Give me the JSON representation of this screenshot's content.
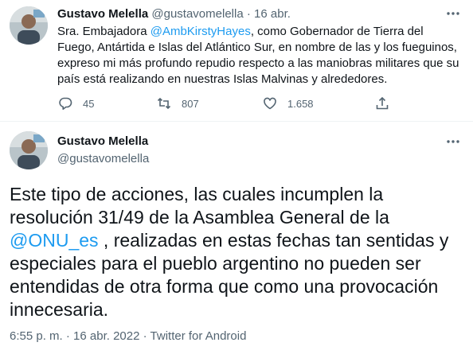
{
  "tweet1": {
    "author_name": "Gustavo Melella",
    "handle": "@gustavomelella",
    "separator": "·",
    "date": "16 abr.",
    "text_before_mention": "Sra. Embajadora ",
    "mention": "@AmbKirstyHayes",
    "text_after_mention": ", como Gobernador de Tierra del Fuego, Antártida e Islas del Atlántico Sur, en nombre de las y los fueguinos, expreso mi más profundo repudio respecto a las maniobras militares que su país está realizando en nuestras Islas Malvinas y alrededores.",
    "reply_count": "45",
    "retweet_count": "807",
    "like_count": "1.658"
  },
  "tweet2": {
    "author_name": "Gustavo Melella",
    "handle": "@gustavomelella",
    "text_before_mention": "Este tipo de acciones, las cuales incumplen la resolución 31/49 de la Asamblea General de la ",
    "mention": "@ONU_es",
    "text_after_mention": " , realizadas en estas fechas tan sentidas y especiales para el pueblo argentino no pueden ser entendidas de otra forma que como una provocación innecesaria.",
    "time": "6:55 p. m.",
    "separator": "·",
    "date": "16 abr. 2022",
    "source": "Twitter for Android"
  },
  "colors": {
    "accent": "#1d9bf0",
    "muted": "#536471",
    "text": "#0f1419"
  },
  "icons": [
    "avatar",
    "more-icon",
    "reply-icon",
    "retweet-icon",
    "like-icon",
    "share-icon"
  ]
}
